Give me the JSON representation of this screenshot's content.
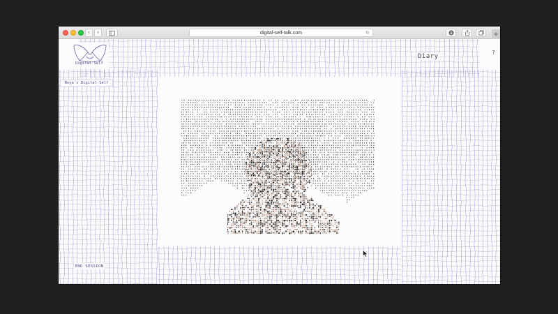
{
  "browser": {
    "url": "digital-self-talk.com",
    "new_tab_label": "+"
  },
  "site": {
    "logo_label": "Digital Self",
    "nav_link": "Diary",
    "help_label": "?",
    "self_chip_label": "Noya's Digital-Self",
    "end_session_label": "END SESSION"
  },
  "colors": {
    "grid_line": "#7d7ad6",
    "text_accent": "#4a4a8a",
    "background": "#fbfafd"
  }
}
